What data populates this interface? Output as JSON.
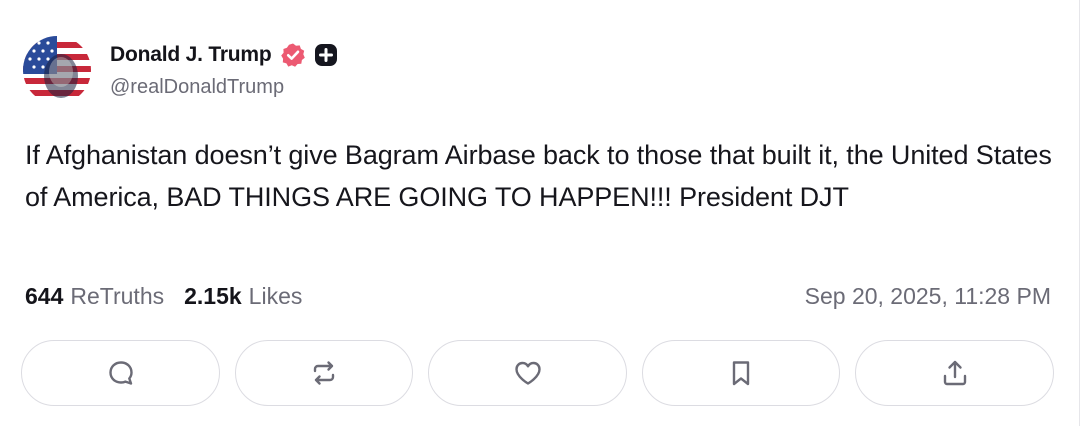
{
  "author": {
    "name": "Donald J. Trump",
    "handle": "@realDonaldTrump",
    "avatar_icon": "flag-portrait-avatar",
    "verified_icon": "verified-badge-icon",
    "plus_icon": "plus-badge-icon",
    "verified_color": "#ec5a72"
  },
  "post": {
    "text": "If Afghanistan doesn’t give Bagram Airbase back to those that built it, the United States of America, BAD THINGS ARE GOING TO HAPPEN!!! President DJT"
  },
  "stats": {
    "retruths_count": "644",
    "retruths_label": "ReTruths",
    "likes_count": "2.15k",
    "likes_label": "Likes"
  },
  "timestamp": "Sep 20, 2025, 11:28 PM",
  "actions": [
    {
      "name": "reply",
      "icon": "reply-icon"
    },
    {
      "name": "retruth",
      "icon": "retruth-icon"
    },
    {
      "name": "like",
      "icon": "heart-icon"
    },
    {
      "name": "bookmark",
      "icon": "bookmark-icon"
    },
    {
      "name": "share",
      "icon": "share-icon"
    }
  ]
}
